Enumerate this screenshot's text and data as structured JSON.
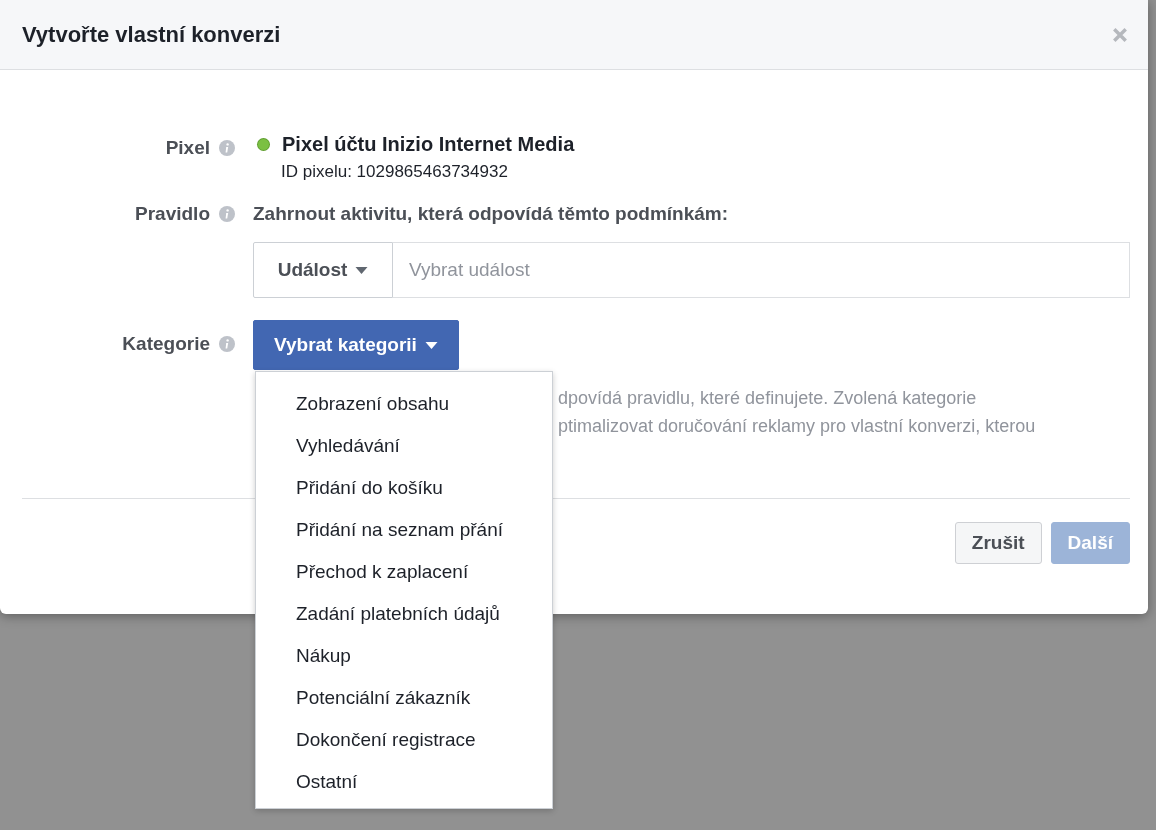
{
  "dialog": {
    "title": "Vytvořte vlastní konverzi",
    "pixel": {
      "label": "Pixel",
      "name": "Pixel účtu Inizio Internet Media",
      "color": "#7bc043",
      "id_text": "ID pixelu: 1029865463734932"
    },
    "rule": {
      "label": "Pravidlo",
      "text": "Zahrnout aktivitu, která odpovídá těmto podmínkám:",
      "event_button": "Událost",
      "event_placeholder": "Vybrat událost"
    },
    "category": {
      "label": "Kategorie",
      "button": "Vybrat kategorii",
      "help_lines": [
        "dpovídá pravidlu, které definujete. Zvolená kategorie",
        "ptimalizovat doručování reklamy pro vlastní konverzi, kterou"
      ],
      "menu": {
        "expanded": true,
        "items": [
          {
            "label": "Zobrazení obsahu"
          },
          {
            "label": "Vyhledávání"
          },
          {
            "label": "Přidání do košíku"
          },
          {
            "label": "Přidání na seznam přání"
          },
          {
            "label": "Přechod k zaplacení"
          },
          {
            "label": "Zadání platebních údajů"
          },
          {
            "label": "Nákup"
          },
          {
            "label": "Potenciální zákazník"
          },
          {
            "label": "Dokončení registrace"
          },
          {
            "label": "Ostatní"
          }
        ]
      }
    },
    "buttons": [
      {
        "label": "Zrušit",
        "kind": "secondary",
        "disabled": false
      },
      {
        "label": "Další",
        "kind": "primary",
        "disabled": true
      }
    ]
  }
}
